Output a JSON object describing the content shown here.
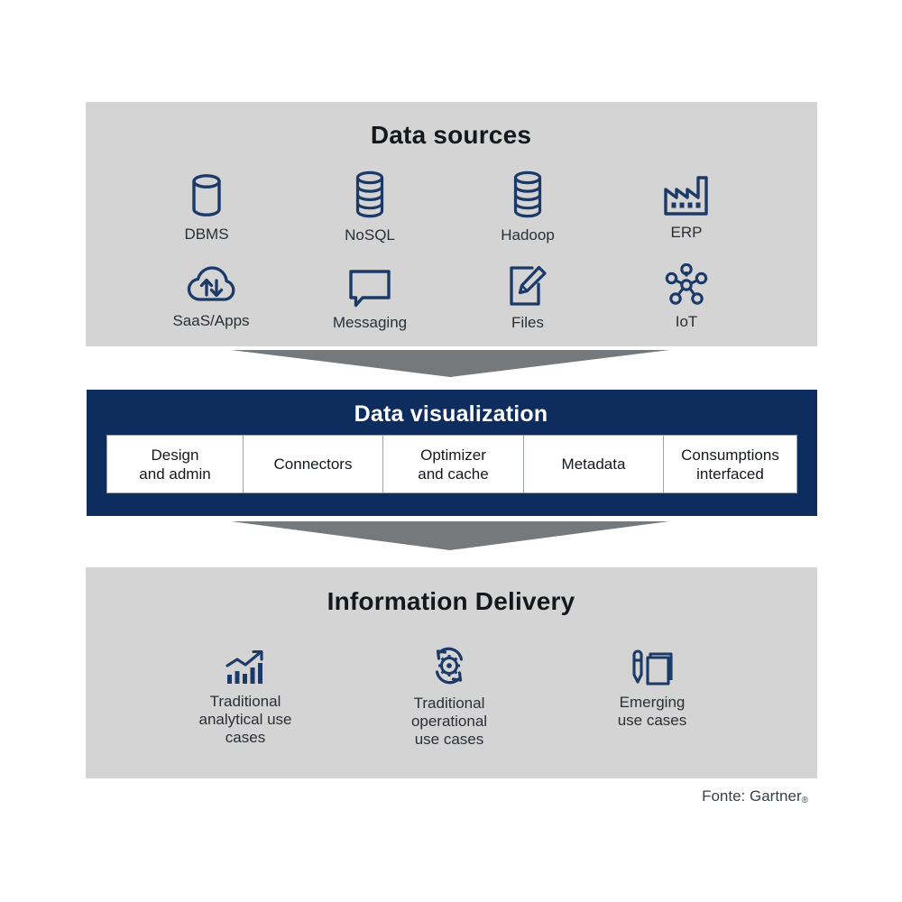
{
  "colors": {
    "panel_gray": "#d4d4d4",
    "panel_navy": "#0d2d5e",
    "icon_navy": "#1b3a68",
    "arrow_gray": "#75797c",
    "text_dark": "#14171c",
    "text_white": "#ffffff"
  },
  "data_sources": {
    "title": "Data sources",
    "items": [
      {
        "label": "DBMS",
        "icon": "database-cylinder-icon"
      },
      {
        "label": "NoSQL",
        "icon": "stacked-database-icon"
      },
      {
        "label": "Hadoop",
        "icon": "stacked-database-icon"
      },
      {
        "label": "ERP",
        "icon": "factory-icon"
      },
      {
        "label": "SaaS/Apps",
        "icon": "cloud-sync-icon"
      },
      {
        "label": "Messaging",
        "icon": "speech-bubble-icon"
      },
      {
        "label": "Files",
        "icon": "document-pencil-icon"
      },
      {
        "label": "IoT",
        "icon": "network-hub-icon"
      }
    ]
  },
  "data_visualization": {
    "title": "Data visualization",
    "capabilities": [
      {
        "label": "Design\nand admin"
      },
      {
        "label": "Connectors"
      },
      {
        "label": "Optimizer\nand cache"
      },
      {
        "label": "Metadata"
      },
      {
        "label": "Consumptions\ninterfaced"
      }
    ]
  },
  "information_delivery": {
    "title": "Information Delivery",
    "items": [
      {
        "label": "Traditional\nanalytical use\ncases",
        "icon": "bar-chart-trend-icon"
      },
      {
        "label": "Traditional\noperational\nuse cases",
        "icon": "gear-refresh-icon"
      },
      {
        "label": "Emerging\nuse cases",
        "icon": "pen-pages-icon"
      }
    ]
  },
  "footer": {
    "source_label": "Fonte: Gartner",
    "registered_mark": "®"
  }
}
